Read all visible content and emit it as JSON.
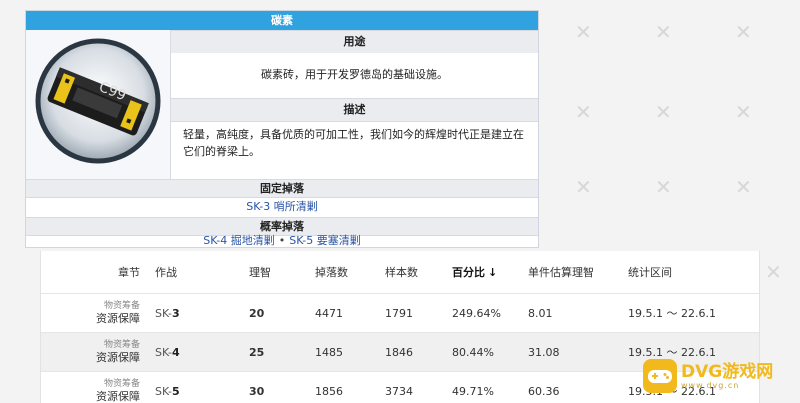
{
  "infobox": {
    "title": "碳素",
    "usage_header": "用途",
    "usage_text": "碳素砖，用于开发罗德岛的基础设施。",
    "desc_header": "描述",
    "desc_text": "轻量，高纯度，具备优质的可加工性，我们如今的辉煌时代正是建立在它们的脊梁上。",
    "fixed_header": "固定掉落",
    "fixed_drop": "SK-3 哨所清剿",
    "prob_header": "概率掉落",
    "prob_drops": [
      "SK-4 掘地清剿",
      "SK-5 要塞清剿"
    ],
    "item_image_text": "C99"
  },
  "table": {
    "headers": [
      "章节",
      "作战",
      "理智",
      "掉落数",
      "样本数",
      "百分比",
      "单件估算理智",
      "统计区间"
    ],
    "sort_arrow": "↓",
    "rows": [
      {
        "zone_small": "物资筹备",
        "zone_main": "资源保障",
        "stage_prefix": "SK-",
        "stage_num": "3",
        "sanity": "20",
        "drops": "4471",
        "samples": "1791",
        "percent": "249.64%",
        "est": "8.01",
        "range": "19.5.1 ～ 22.6.1"
      },
      {
        "zone_small": "物资筹备",
        "zone_main": "资源保障",
        "stage_prefix": "SK-",
        "stage_num": "4",
        "sanity": "25",
        "drops": "1485",
        "samples": "1846",
        "percent": "80.44%",
        "est": "31.08",
        "range": "19.5.1 ～ 22.6.1"
      },
      {
        "zone_small": "物资筹备",
        "zone_main": "资源保障",
        "stage_prefix": "SK-",
        "stage_num": "5",
        "sanity": "30",
        "drops": "1856",
        "samples": "3734",
        "percent": "49.71%",
        "est": "60.36",
        "range": "19.5.1 ～ 22.6.1"
      }
    ]
  },
  "logo": {
    "name": "DVG游戏网",
    "domain": "www.dvg.cn"
  },
  "colors": {
    "title_bar": "#2fa2df",
    "sanity": "#e8502a",
    "logo": "#f2b91c",
    "link": "#2a55a6"
  }
}
